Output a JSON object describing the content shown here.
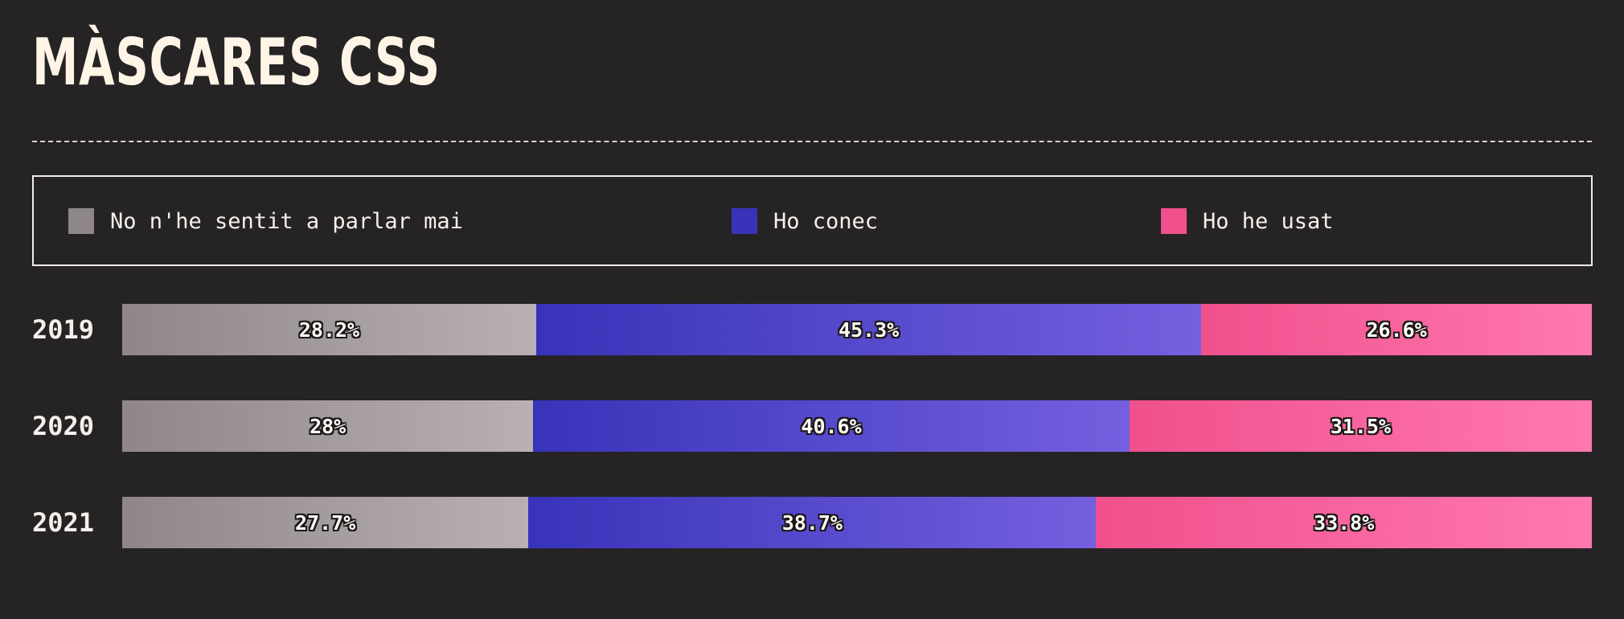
{
  "title": "MÀSCARES CSS",
  "legend": [
    {
      "label": "No n'he sentit a parlar mai",
      "color": "#8e868b",
      "icon": "gray-square-icon"
    },
    {
      "label": "Ho conec",
      "color": "#3833b9",
      "icon": "blue-square-icon"
    },
    {
      "label": "Ho he usat",
      "color": "#f0508c",
      "icon": "pink-square-icon"
    }
  ],
  "colors": {
    "never_heard": [
      "#8e868b",
      "#b8b0b2"
    ],
    "know_about": [
      "#3833b9",
      "#7460df"
    ],
    "used": [
      "#f0508c",
      "#ff78b0"
    ]
  },
  "chart_data": {
    "type": "bar",
    "orientation": "horizontal",
    "stacked": true,
    "categories": [
      "2019",
      "2020",
      "2021"
    ],
    "series": [
      {
        "name": "No n'he sentit a parlar mai",
        "values": [
          28.2,
          28,
          27.7
        ],
        "labels": [
          "28.2%",
          "28%",
          "27.7%"
        ]
      },
      {
        "name": "Ho conec",
        "values": [
          45.3,
          40.6,
          38.7
        ],
        "labels": [
          "45.3%",
          "40.6%",
          "38.7%"
        ]
      },
      {
        "name": "Ho he usat",
        "values": [
          26.6,
          31.5,
          33.8
        ],
        "labels": [
          "26.6%",
          "31.5%",
          "33.8%"
        ]
      }
    ],
    "legend_position": "top"
  }
}
